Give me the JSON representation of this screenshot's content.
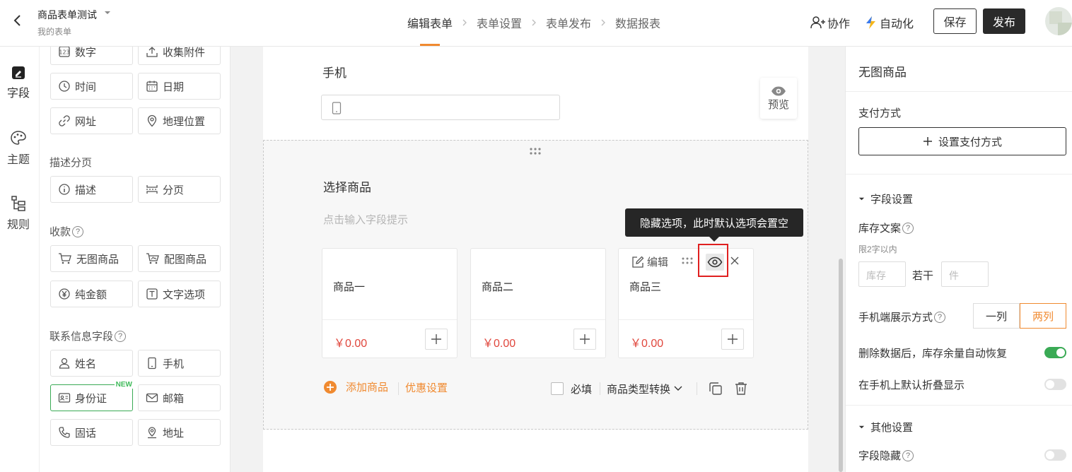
{
  "header": {
    "title": "商品表单测试",
    "subtitle": "我的表单",
    "steps": [
      "编辑表单",
      "表单设置",
      "表单发布",
      "数据报表"
    ],
    "collaborate": "协作",
    "automate": "自动化",
    "save": "保存",
    "publish": "发布"
  },
  "leftnav": {
    "fields": "字段",
    "theme": "主题",
    "rules": "规则"
  },
  "palette": {
    "btn_number": "数字",
    "btn_attach": "收集附件",
    "btn_time": "时间",
    "btn_date": "日期",
    "btn_url": "网址",
    "btn_location": "地理位置",
    "sec_desc": "描述分页",
    "btn_desc": "描述",
    "btn_page": "分页",
    "sec_pay": "收款",
    "btn_noimg": "无图商品",
    "btn_img": "配图商品",
    "btn_amount": "纯金额",
    "btn_textopt": "文字选项",
    "sec_contact": "联系信息字段",
    "btn_name": "姓名",
    "btn_mobile": "手机",
    "btn_idcard": "身份证",
    "new_tag": "NEW",
    "btn_email": "邮箱",
    "btn_tel": "固话",
    "btn_address": "地址"
  },
  "canvas": {
    "phone_label": "手机",
    "preview": "预览",
    "select_title": "选择商品",
    "select_hint": "点击输入字段提示",
    "products": [
      {
        "name": "商品一",
        "price": "￥0.00"
      },
      {
        "name": "商品二",
        "price": "￥0.00"
      },
      {
        "name": "商品三",
        "price": "￥0.00"
      }
    ],
    "edit": "编辑",
    "tooltip": "隐藏选项，此时默认选项会置空",
    "add_product": "添加商品",
    "discount": "优惠设置",
    "required": "必填",
    "type_convert": "商品类型转换"
  },
  "right": {
    "title": "无图商品",
    "payment": "支付方式",
    "set_payment": "设置支付方式",
    "field_settings": "字段设置",
    "stock_label": "库存文案",
    "stock_hint": "限2字以内",
    "stock_ph1": "库存",
    "stock_mid": "若干",
    "stock_ph2": "件",
    "mobile_display": "手机端展示方式",
    "one_col": "一列",
    "two_col": "两列",
    "restore_stock": "删除数据后，库存余量自动恢复",
    "collapse_mobile": "在手机上默认折叠显示",
    "other_settings": "其他设置",
    "hide_field": "字段隐藏"
  },
  "colors": {
    "accent": "#f08a30",
    "price": "#e0463c",
    "toggle_on": "#3aaa55",
    "highlight": "#e02020"
  }
}
